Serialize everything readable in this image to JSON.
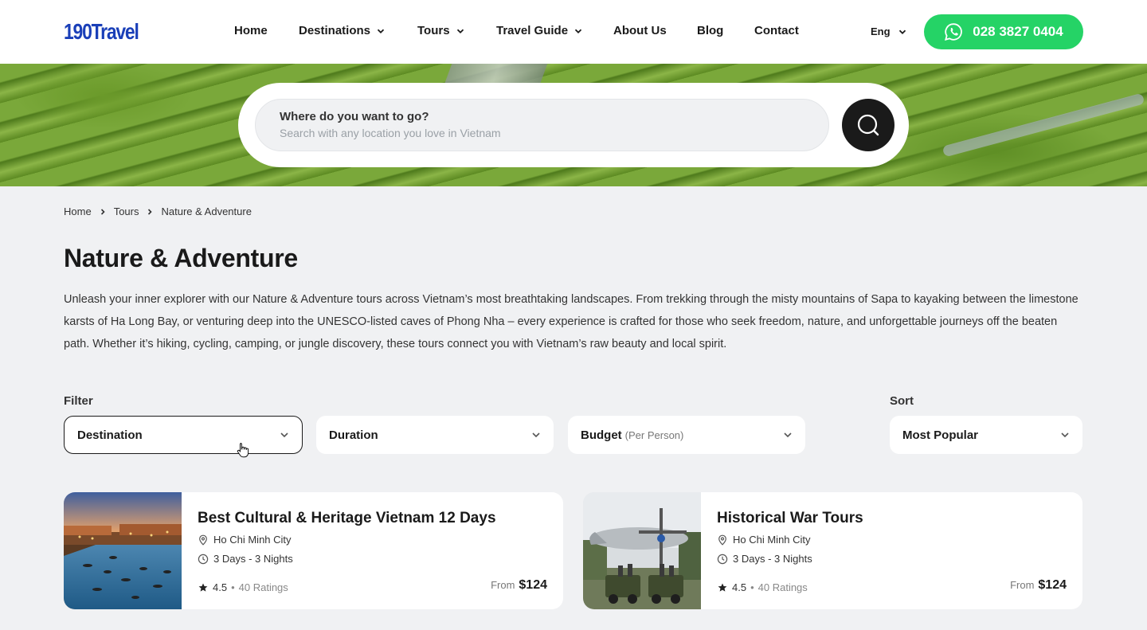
{
  "header": {
    "logo": "190Travel",
    "nav": [
      {
        "label": "Home",
        "dropdown": false
      },
      {
        "label": "Destinations",
        "dropdown": true
      },
      {
        "label": "Tours",
        "dropdown": true
      },
      {
        "label": "Travel Guide",
        "dropdown": true
      },
      {
        "label": "About Us",
        "dropdown": false
      },
      {
        "label": "Blog",
        "dropdown": false
      },
      {
        "label": "Contact",
        "dropdown": false
      }
    ],
    "language": "Eng",
    "phone": "028 3827 0404",
    "brand_color": "#1a3fb8",
    "whatsapp_color": "#25d366"
  },
  "search": {
    "label": "Where do you want to go?",
    "placeholder": "Search with any location you love in Vietnam"
  },
  "breadcrumb": [
    "Home",
    "Tours",
    "Nature & Adventure"
  ],
  "page": {
    "title": "Nature & Adventure",
    "description": "Unleash your inner explorer with our Nature & Adventure tours across Vietnam’s most breathtaking landscapes. From trekking through the misty mountains of Sapa to kayaking between the limestone karsts of Ha Long Bay, or venturing deep into the UNESCO-listed caves of Phong Nha – every experience is crafted for those who seek freedom, nature, and unforgettable journeys off the beaten path. Whether it’s hiking, cycling, camping, or jungle discovery, these tours connect you with Vietnam’s raw beauty and local spirit."
  },
  "filters": {
    "label": "Filter",
    "destination": "Destination",
    "duration": "Duration",
    "budget": "Budget",
    "budget_sub": "(Per Person)"
  },
  "sort": {
    "label": "Sort",
    "value": "Most Popular"
  },
  "tours": [
    {
      "title": "Best Cultural & Heritage Vietnam 12 Days",
      "location": "Ho Chi Minh City",
      "duration": "3 Days - 3 Nights",
      "rating": "4.5",
      "ratings_count": "40 Ratings",
      "from_label": "From",
      "price": "$124"
    },
    {
      "title": "Historical War Tours",
      "location": "Ho Chi Minh City",
      "duration": "3 Days - 3 Nights",
      "rating": "4.5",
      "ratings_count": "40 Ratings",
      "from_label": "From",
      "price": "$124"
    }
  ]
}
